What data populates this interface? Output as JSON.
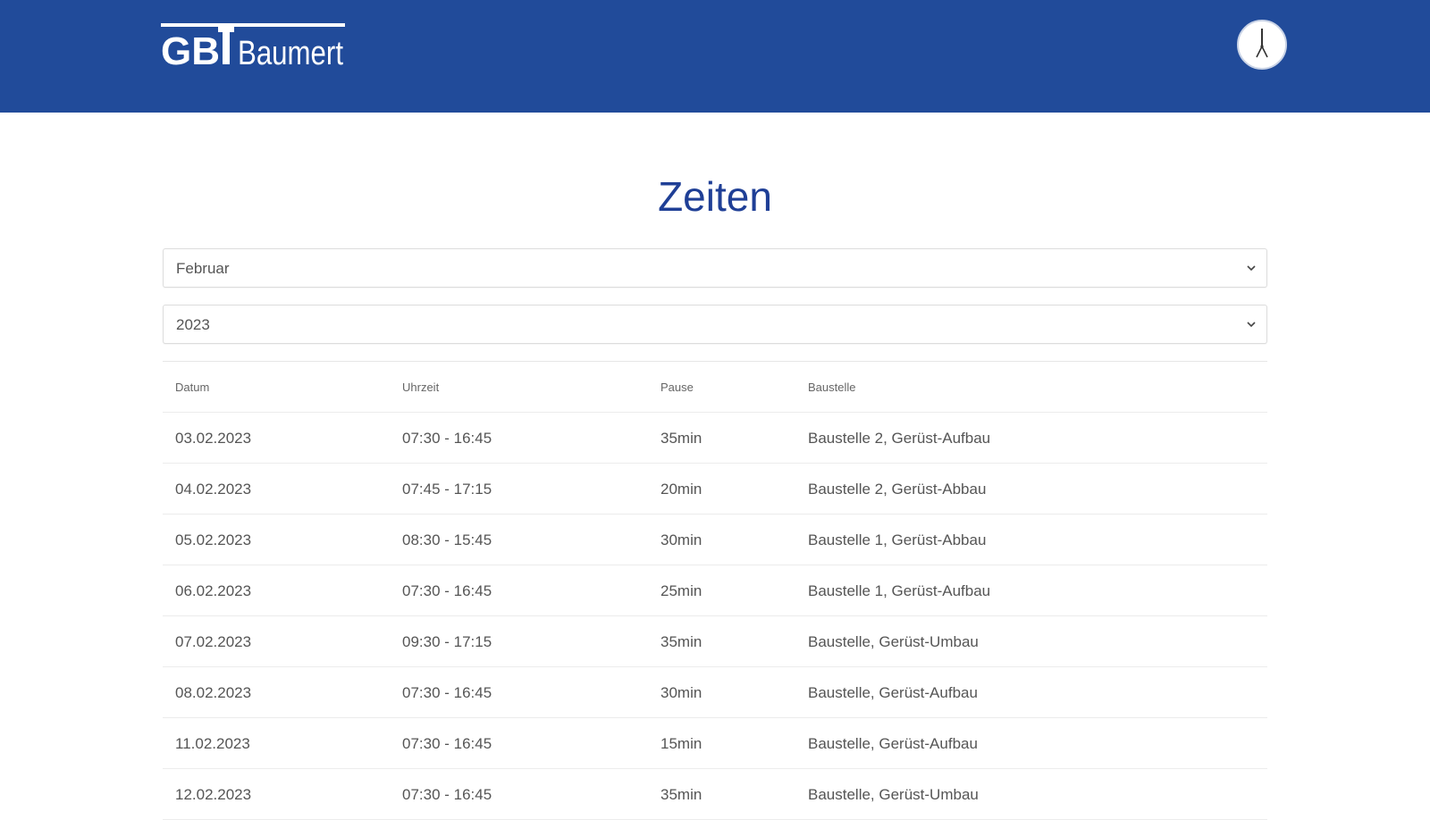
{
  "header": {
    "logo_text": "GBT Baumert",
    "brand_color": "#214b9a",
    "clock_icon": "clock-icon"
  },
  "page": {
    "title": "Zeiten"
  },
  "filters": {
    "month": "Februar",
    "year": "2023"
  },
  "table": {
    "columns": [
      "Datum",
      "Uhrzeit",
      "Pause",
      "Baustelle"
    ],
    "rows": [
      {
        "datum": "03.02.2023",
        "uhrzeit": "07:30 - 16:45",
        "pause": "35min",
        "baustelle": "Baustelle 2, Gerüst-Aufbau"
      },
      {
        "datum": "04.02.2023",
        "uhrzeit": "07:45 - 17:15",
        "pause": "20min",
        "baustelle": "Baustelle 2, Gerüst-Abbau"
      },
      {
        "datum": "05.02.2023",
        "uhrzeit": "08:30 - 15:45",
        "pause": "30min",
        "baustelle": "Baustelle 1, Gerüst-Abbau"
      },
      {
        "datum": "06.02.2023",
        "uhrzeit": "07:30 - 16:45",
        "pause": "25min",
        "baustelle": "Baustelle 1, Gerüst-Aufbau"
      },
      {
        "datum": "07.02.2023",
        "uhrzeit": "09:30 - 17:15",
        "pause": "35min",
        "baustelle": "Baustelle, Gerüst-Umbau"
      },
      {
        "datum": "08.02.2023",
        "uhrzeit": "07:30 - 16:45",
        "pause": "30min",
        "baustelle": "Baustelle, Gerüst-Aufbau"
      },
      {
        "datum": "11.02.2023",
        "uhrzeit": "07:30 - 16:45",
        "pause": "15min",
        "baustelle": "Baustelle, Gerüst-Aufbau"
      },
      {
        "datum": "12.02.2023",
        "uhrzeit": "07:30 - 16:45",
        "pause": "35min",
        "baustelle": "Baustelle, Gerüst-Umbau"
      }
    ]
  }
}
